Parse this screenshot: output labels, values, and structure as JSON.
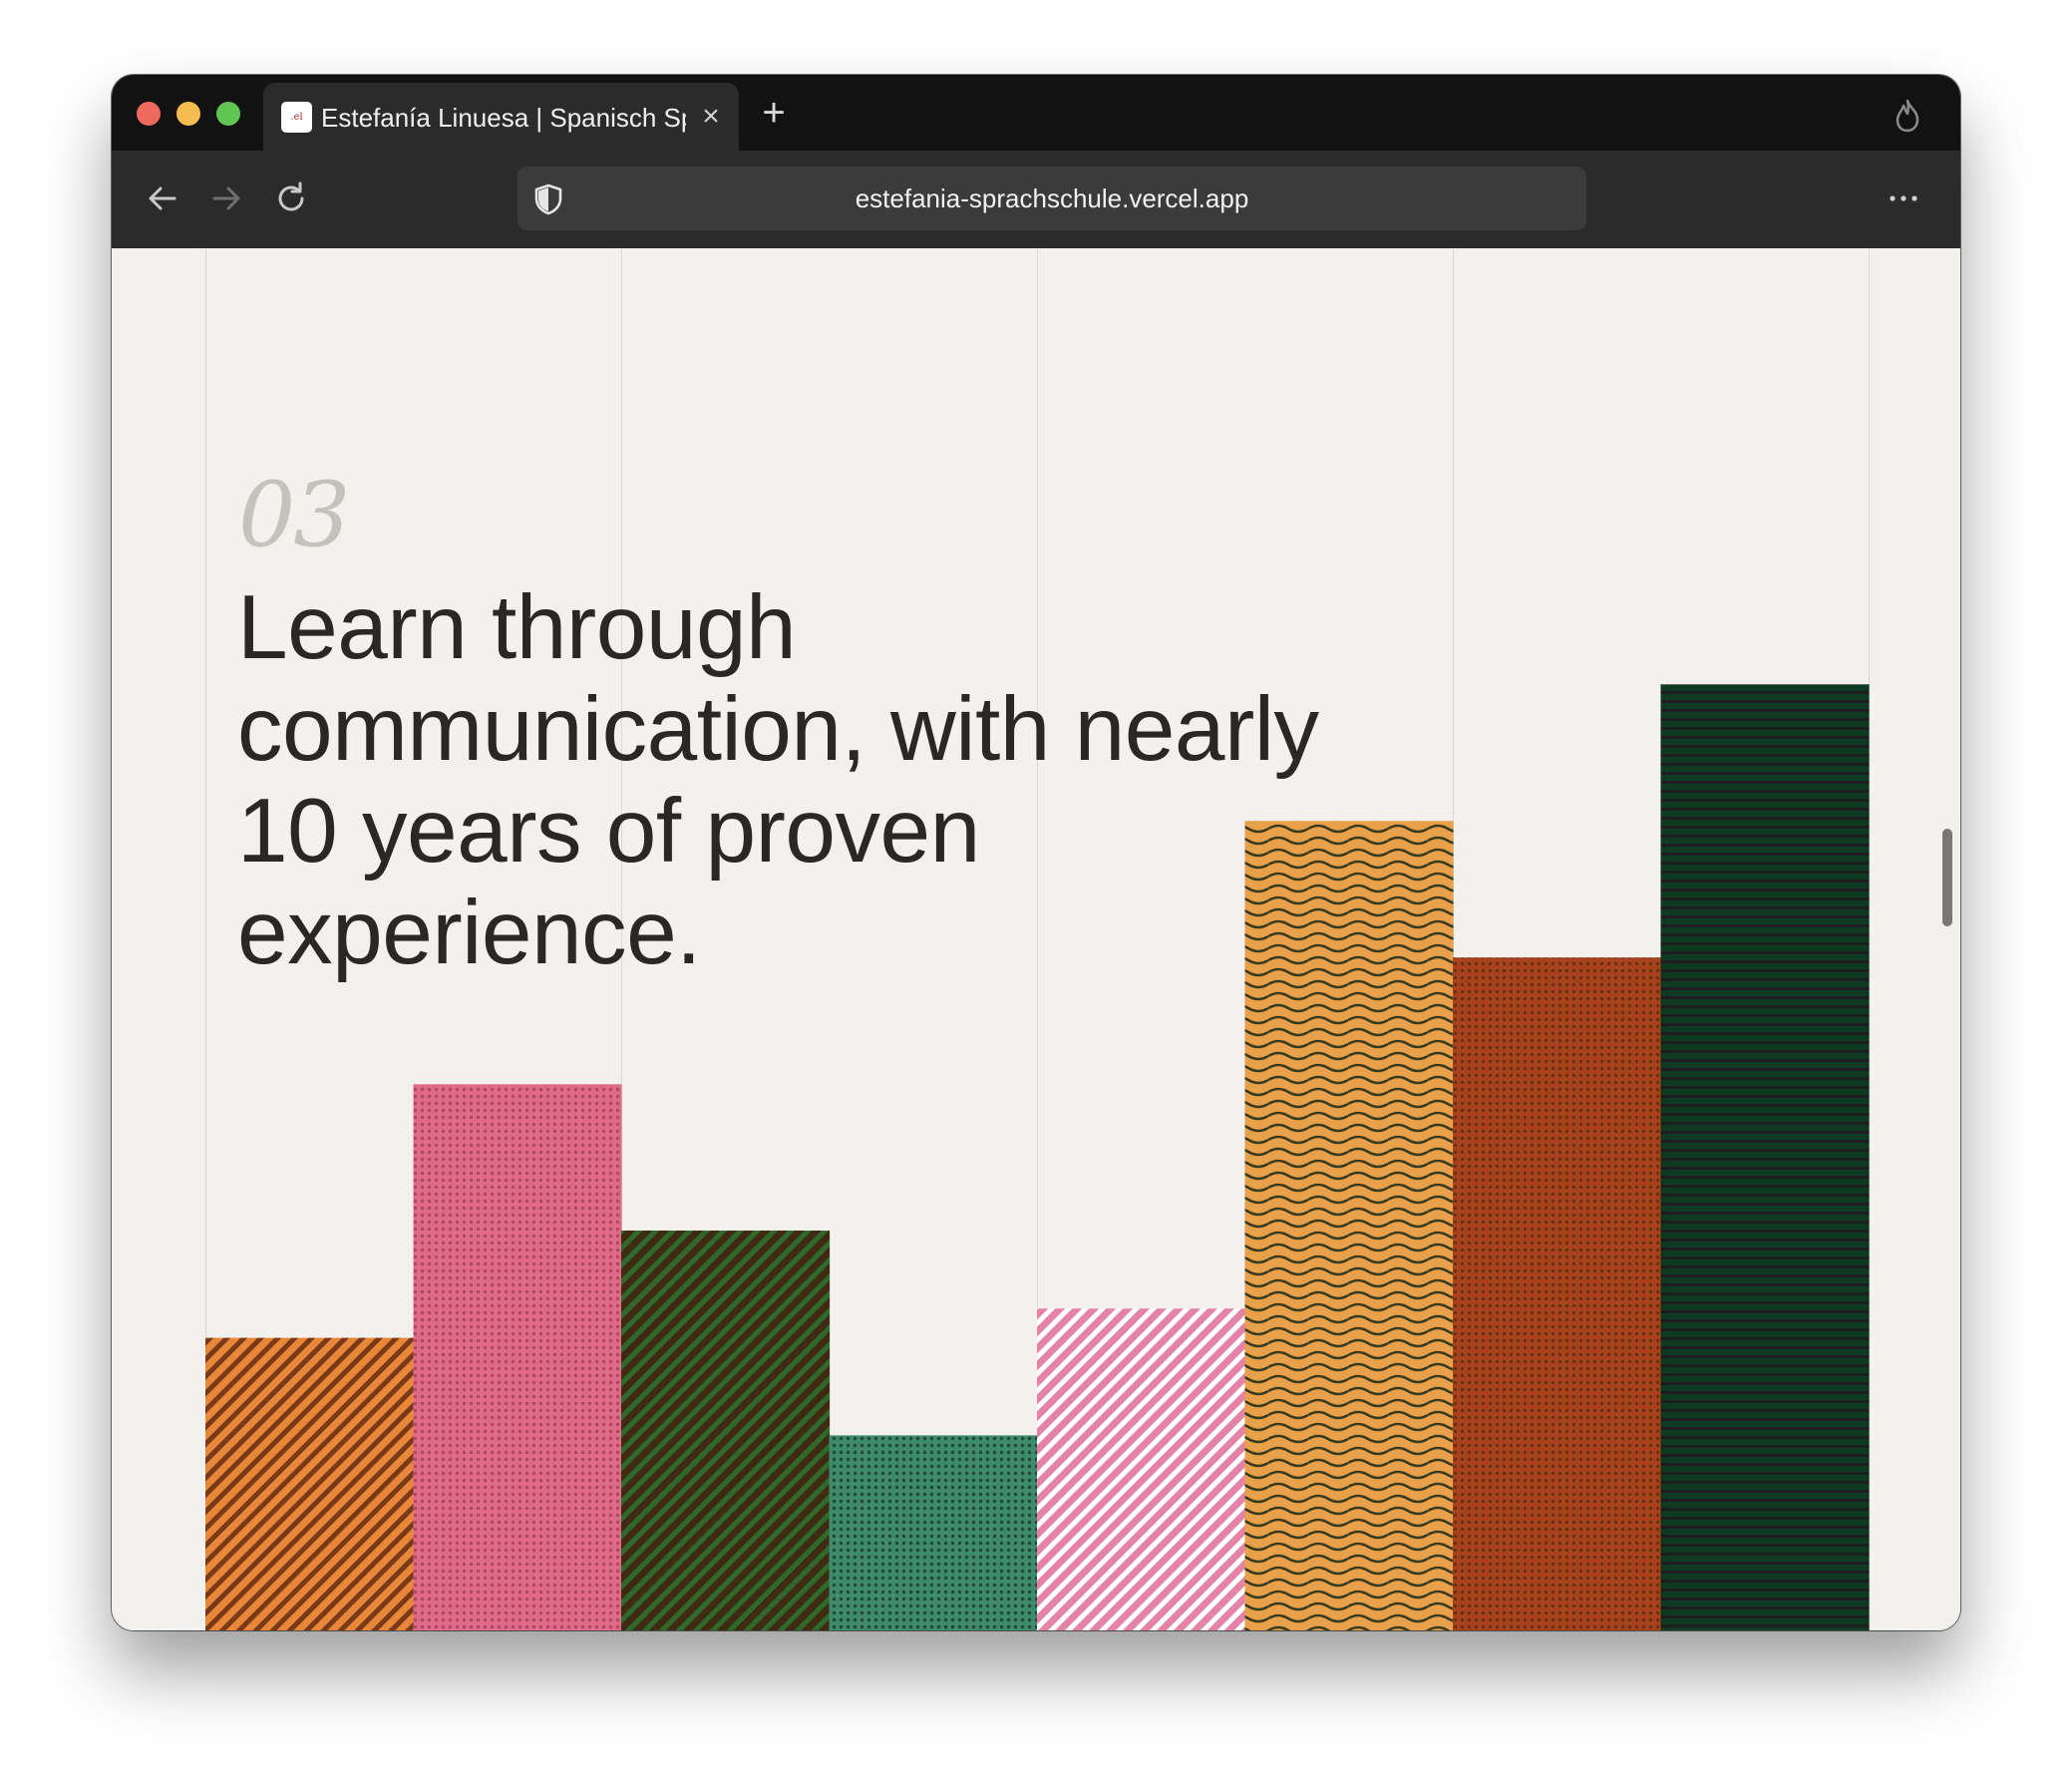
{
  "browser": {
    "tab_title": "Estefanía Linuesa | Spanisch Sprachschule",
    "favicon_text": ".el",
    "close_glyph": "×",
    "new_tab_glyph": "+",
    "url": "estefania-sprachschule.vercel.app",
    "icons": [
      "back-arrow-icon",
      "forward-arrow-icon",
      "reload-icon",
      "shield-icon",
      "fire-icon",
      "more-menu-icon",
      "close-icon",
      "plus-icon"
    ]
  },
  "section": {
    "number": "03",
    "headline_lines": [
      "Learn through",
      "communication, with nearly",
      "10 years of proven",
      "experience."
    ]
  },
  "colors": {
    "page_bg": "#f3f1ed",
    "text": "#2a2725",
    "number": "#c5c2bd",
    "bars": [
      "#e8873a",
      "#e06a8a",
      "#3f2a14",
      "#3f8a68",
      "#e482a8",
      "#e8a04a",
      "#a8421c",
      "#0f3a22"
    ]
  },
  "chart_data": {
    "type": "bar",
    "categories": [],
    "values": [
      30,
      56,
      41,
      20,
      33,
      83,
      69,
      97
    ],
    "ylim": [
      0,
      100
    ],
    "patterns": [
      "diagonal-stripes",
      "dots",
      "diagonal-stripes",
      "dots",
      "diagonal-stripes",
      "waves",
      "dots",
      "horizontal-lines"
    ],
    "grid": "vertical-lines"
  }
}
